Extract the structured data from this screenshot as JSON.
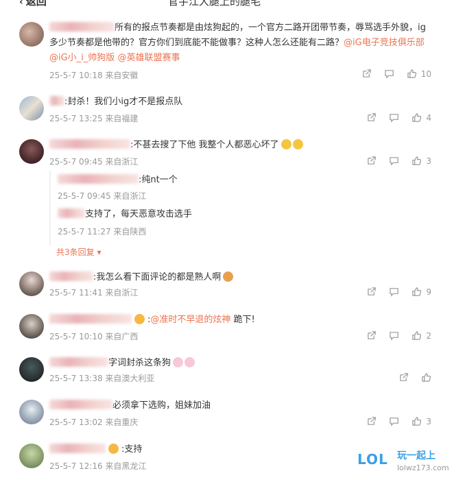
{
  "header": {
    "back_label": "返回",
    "title": "官宇江大腿上的腿毛"
  },
  "comments": [
    {
      "prefix": "",
      "text": "所有的报点节奏都是由炫狗起的，一个官方二路开团带节奏，辱骂选手外貌，ig多少节奏都是他带的？官方你们到底能不能做事？这种人怎么还能有二路？",
      "mention1": "@iG电子竞技俱乐部",
      "mention2": "@iG小_i_帅狗版",
      "mention3": "@英雄联盟赛事",
      "meta": "25-5-7 10:18 来自安徽",
      "likes": "10"
    },
    {
      "text": ":封杀！我们小ig才不是报点队",
      "meta": "25-5-7 13:25 来自福建",
      "likes": "4"
    },
    {
      "text": ":不甚去搜了下他 我整个人都恶心坏了",
      "meta": "25-5-7 09:45 来自浙江",
      "likes": "3",
      "replies": [
        {
          "text": ":纯nt一个",
          "meta": "25-5-7 09:45 来自浙江"
        },
        {
          "text": "支持了，每天恶意攻击选手",
          "meta": "25-5-7 11:27 来自陕西"
        }
      ],
      "more": "共3条回复"
    },
    {
      "text": ":我怎么看下面评论的都是熟人啊",
      "meta": "25-5-7 11:41 来自浙江",
      "likes": "9"
    },
    {
      "text": ":",
      "mention": "@准时不早退的炫神",
      "text_after": " 跪下!",
      "meta": "25-5-7 10:10 来自广西",
      "likes": "2"
    },
    {
      "text": "字词封杀这条狗",
      "meta": "25-5-7 13:38 来自澳大利亚",
      "likes": ""
    },
    {
      "text": "必须拿下选购，姐妹加油",
      "meta": "25-5-7 13:02 来自重庆",
      "likes": "3"
    },
    {
      "text": ":支持",
      "meta": "25-5-7 12:16 来自黑龙江",
      "likes": ""
    }
  ],
  "watermark": {
    "logo": "LOL",
    "line1": "玩一起上",
    "line2": "lolwz173.com"
  },
  "icons": {
    "share": "share-icon",
    "comment": "comment-icon",
    "like": "like-icon"
  },
  "colors": {
    "mention": "#eb7350",
    "meta": "#999999"
  }
}
